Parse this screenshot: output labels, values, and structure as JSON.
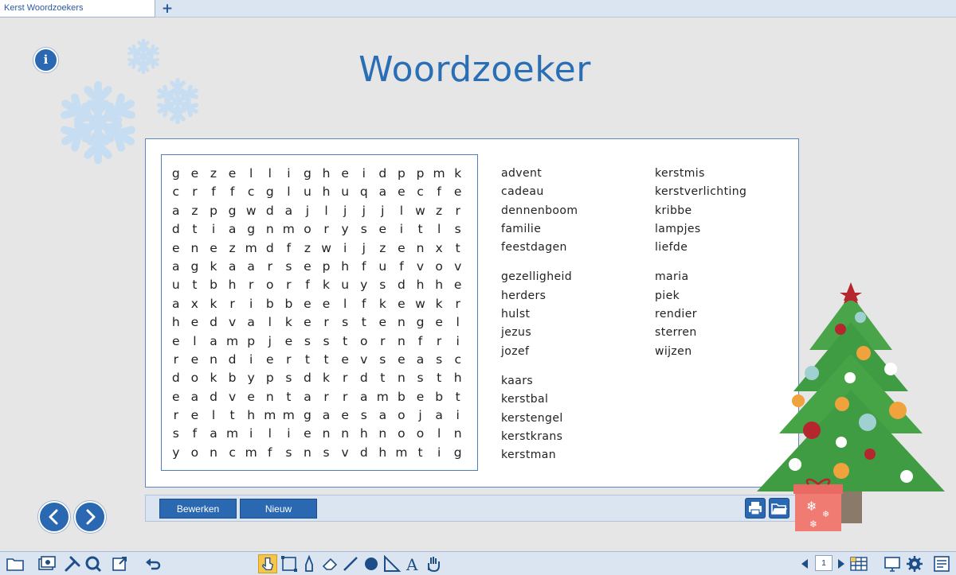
{
  "tabs": [
    {
      "label": "Kerst Woordzoekers"
    }
  ],
  "new_tab_label": "+",
  "info_label": "i",
  "title": "Woordzoeker",
  "grid": [
    [
      "g",
      "e",
      "z",
      "e",
      "l",
      "l",
      "i",
      "g",
      "h",
      "e",
      "i",
      "d",
      "p",
      "p",
      "m",
      "k"
    ],
    [
      "c",
      "r",
      "f",
      "f",
      "c",
      "g",
      "l",
      "u",
      "h",
      "u",
      "q",
      "a",
      "e",
      "c",
      "f",
      "e"
    ],
    [
      "a",
      "z",
      "p",
      "g",
      "w",
      "d",
      "a",
      "j",
      "l",
      "j",
      "j",
      "j",
      "l",
      "w",
      "z",
      "r"
    ],
    [
      "d",
      "t",
      "i",
      "a",
      "g",
      "n",
      "m",
      "o",
      "r",
      "y",
      "s",
      "e",
      "i",
      "t",
      "l",
      "s"
    ],
    [
      "e",
      "n",
      "e",
      "z",
      "m",
      "d",
      "f",
      "z",
      "w",
      "i",
      "j",
      "z",
      "e",
      "n",
      "x",
      "t"
    ],
    [
      "a",
      "g",
      "k",
      "a",
      "a",
      "r",
      "s",
      "e",
      "p",
      "h",
      "f",
      "u",
      "f",
      "v",
      "o",
      "v"
    ],
    [
      "u",
      "t",
      "b",
      "h",
      "r",
      "o",
      "r",
      "f",
      "k",
      "u",
      "y",
      "s",
      "d",
      "h",
      "h",
      "e"
    ],
    [
      "a",
      "x",
      "k",
      "r",
      "i",
      "b",
      "b",
      "e",
      "e",
      "l",
      "f",
      "k",
      "e",
      "w",
      "k",
      "r"
    ],
    [
      "h",
      "e",
      "d",
      "v",
      "a",
      "l",
      "k",
      "e",
      "r",
      "s",
      "t",
      "e",
      "n",
      "g",
      "e",
      "l"
    ],
    [
      "e",
      "l",
      "a",
      "m",
      "p",
      "j",
      "e",
      "s",
      "s",
      "t",
      "o",
      "r",
      "n",
      "f",
      "r",
      "i"
    ],
    [
      "r",
      "e",
      "n",
      "d",
      "i",
      "e",
      "r",
      "t",
      "t",
      "e",
      "v",
      "s",
      "e",
      "a",
      "s",
      "c"
    ],
    [
      "d",
      "o",
      "k",
      "b",
      "y",
      "p",
      "s",
      "d",
      "k",
      "r",
      "d",
      "t",
      "n",
      "s",
      "t",
      "h"
    ],
    [
      "e",
      "a",
      "d",
      "v",
      "e",
      "n",
      "t",
      "a",
      "r",
      "r",
      "a",
      "m",
      "b",
      "e",
      "b",
      "t"
    ],
    [
      "r",
      "e",
      "l",
      "t",
      "h",
      "m",
      "m",
      "g",
      "a",
      "e",
      "s",
      "a",
      "o",
      "j",
      "a",
      "i"
    ],
    [
      "s",
      "f",
      "a",
      "m",
      "i",
      "l",
      "i",
      "e",
      "n",
      "n",
      "h",
      "n",
      "o",
      "o",
      "l",
      "n"
    ],
    [
      "y",
      "o",
      "n",
      "c",
      "m",
      "f",
      "s",
      "n",
      "s",
      "v",
      "d",
      "h",
      "m",
      "t",
      "i",
      "g"
    ]
  ],
  "words_left": [
    [
      "advent",
      "cadeau",
      "dennenboom",
      "familie",
      "feestdagen"
    ],
    [
      "gezelligheid",
      "herders",
      "hulst",
      "jezus",
      "jozef"
    ],
    [
      "kaars",
      "kerstbal",
      "kerstengel",
      "kerstkrans",
      "kerstman"
    ]
  ],
  "words_right": [
    [
      "kerstmis",
      "kerstverlichting",
      "kribbe",
      "lampjes",
      "liefde"
    ],
    [
      "maria",
      "piek",
      "rendier",
      "sterren",
      "wijzen"
    ]
  ],
  "buttons": {
    "edit": "Bewerken",
    "new": "Nieuw"
  },
  "page_number": "1",
  "colors": {
    "accent": "#2a68b1",
    "title": "#2a6fb5",
    "snow": "#c7ddf1"
  },
  "icons": [
    "info-icon",
    "prev-arrow-icon",
    "next-arrow-icon",
    "print-icon",
    "open-folder-icon",
    "folder-icon",
    "pointer-icon"
  ]
}
